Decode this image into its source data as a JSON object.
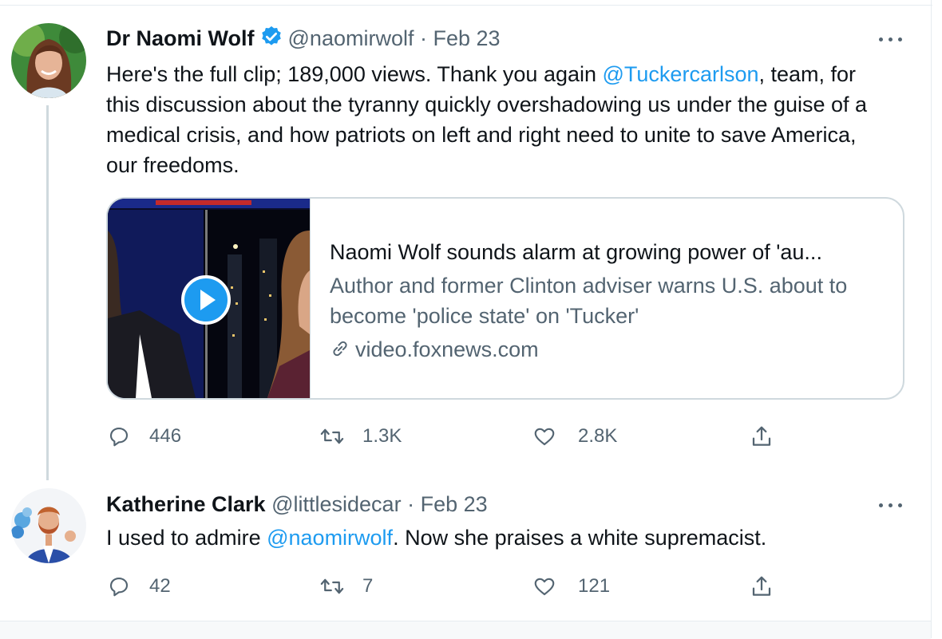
{
  "tweets": [
    {
      "name": "Dr Naomi Wolf",
      "handle": "@naomirwolf",
      "separator": "·",
      "date": "Feb 23",
      "verified": true,
      "text_before": "Here's the full clip; 189,000 views. Thank you again ",
      "mention": "@Tuckercarlson",
      "text_after": ", team, for this discussion about the tyranny quickly overshadowing us under the guise of a medical crisis, and how patriots on left and right need to unite to save America, our freedoms.",
      "card": {
        "title": "Naomi Wolf sounds alarm at growing power of 'au...",
        "description": "Author and former Clinton adviser warns U.S. about to become 'police state' on 'Tucker'",
        "domain": "video.foxnews.com"
      },
      "actions": {
        "replies": "446",
        "retweets": "1.3K",
        "likes": "2.8K"
      }
    },
    {
      "name": "Katherine Clark",
      "handle": "@littlesidecar",
      "separator": "·",
      "date": "Feb 23",
      "verified": false,
      "text_before": "I used to admire ",
      "mention": "@naomirwolf",
      "text_after": ". Now she praises a white supremacist.",
      "actions": {
        "replies": "42",
        "retweets": "7",
        "likes": "121"
      }
    }
  ],
  "icons": {
    "reply": "reply-icon",
    "retweet": "retweet-icon",
    "like": "heart-icon",
    "share": "share-icon",
    "more": "more-icon",
    "verified": "verified-badge-icon",
    "play": "play-icon",
    "link": "link-icon"
  },
  "colors": {
    "accent": "#1d9bf0",
    "secondary_text": "#536471",
    "border": "#cfd9de"
  }
}
